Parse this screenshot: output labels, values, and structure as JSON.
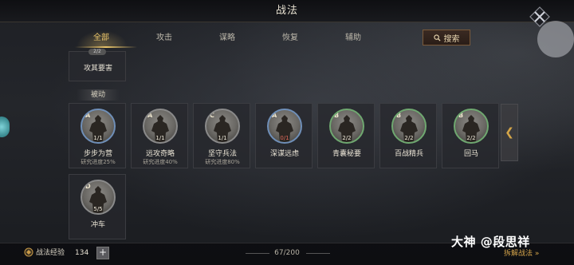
{
  "window": {
    "title": "战法"
  },
  "tabs": [
    {
      "label": "全部",
      "active": true
    },
    {
      "label": "攻击",
      "active": false
    },
    {
      "label": "谋略",
      "active": false
    },
    {
      "label": "恢复",
      "active": false
    },
    {
      "label": "辅助",
      "active": false
    }
  ],
  "search": {
    "label": "搜索"
  },
  "partial_card": {
    "badge": "2/2",
    "name": "攻其要害"
  },
  "section": {
    "passive_label": "被动"
  },
  "cards": [
    {
      "grade": "A",
      "level": "1/1",
      "name": "步步为营",
      "progress": "研究进度25%",
      "ring": "blue"
    },
    {
      "grade": "A",
      "level": "1/1",
      "name": "远攻奇略",
      "progress": "研究进度40%",
      "ring": "grey"
    },
    {
      "grade": "C",
      "level": "1/1",
      "name": "坚守兵法",
      "progress": "研究进度80%",
      "ring": "grey"
    },
    {
      "grade": "A",
      "level": "0/1",
      "name": "深谋远虑",
      "progress": "",
      "ring": "blue"
    },
    {
      "grade": "B",
      "level": "2/2",
      "name": "青囊秘要",
      "progress": "",
      "ring": "green"
    },
    {
      "grade": "B",
      "level": "2/2",
      "name": "百战精兵",
      "progress": "",
      "ring": "green"
    },
    {
      "grade": "B",
      "level": "2/2",
      "name": "回马",
      "progress": "",
      "ring": "green"
    },
    {
      "grade": "D",
      "level": "5/5",
      "name": "冲车",
      "progress": "",
      "ring": "grey"
    }
  ],
  "collapse": {
    "glyph": "❮"
  },
  "bottom": {
    "exp_label": "战法经验",
    "exp_value": "134",
    "plus": "+",
    "count": "67/200",
    "unlock_link": "拆解战法 »"
  },
  "watermark": "大神 @段思祥",
  "colors": {
    "accent": "#e9c46a",
    "link": "#d2a24a"
  }
}
